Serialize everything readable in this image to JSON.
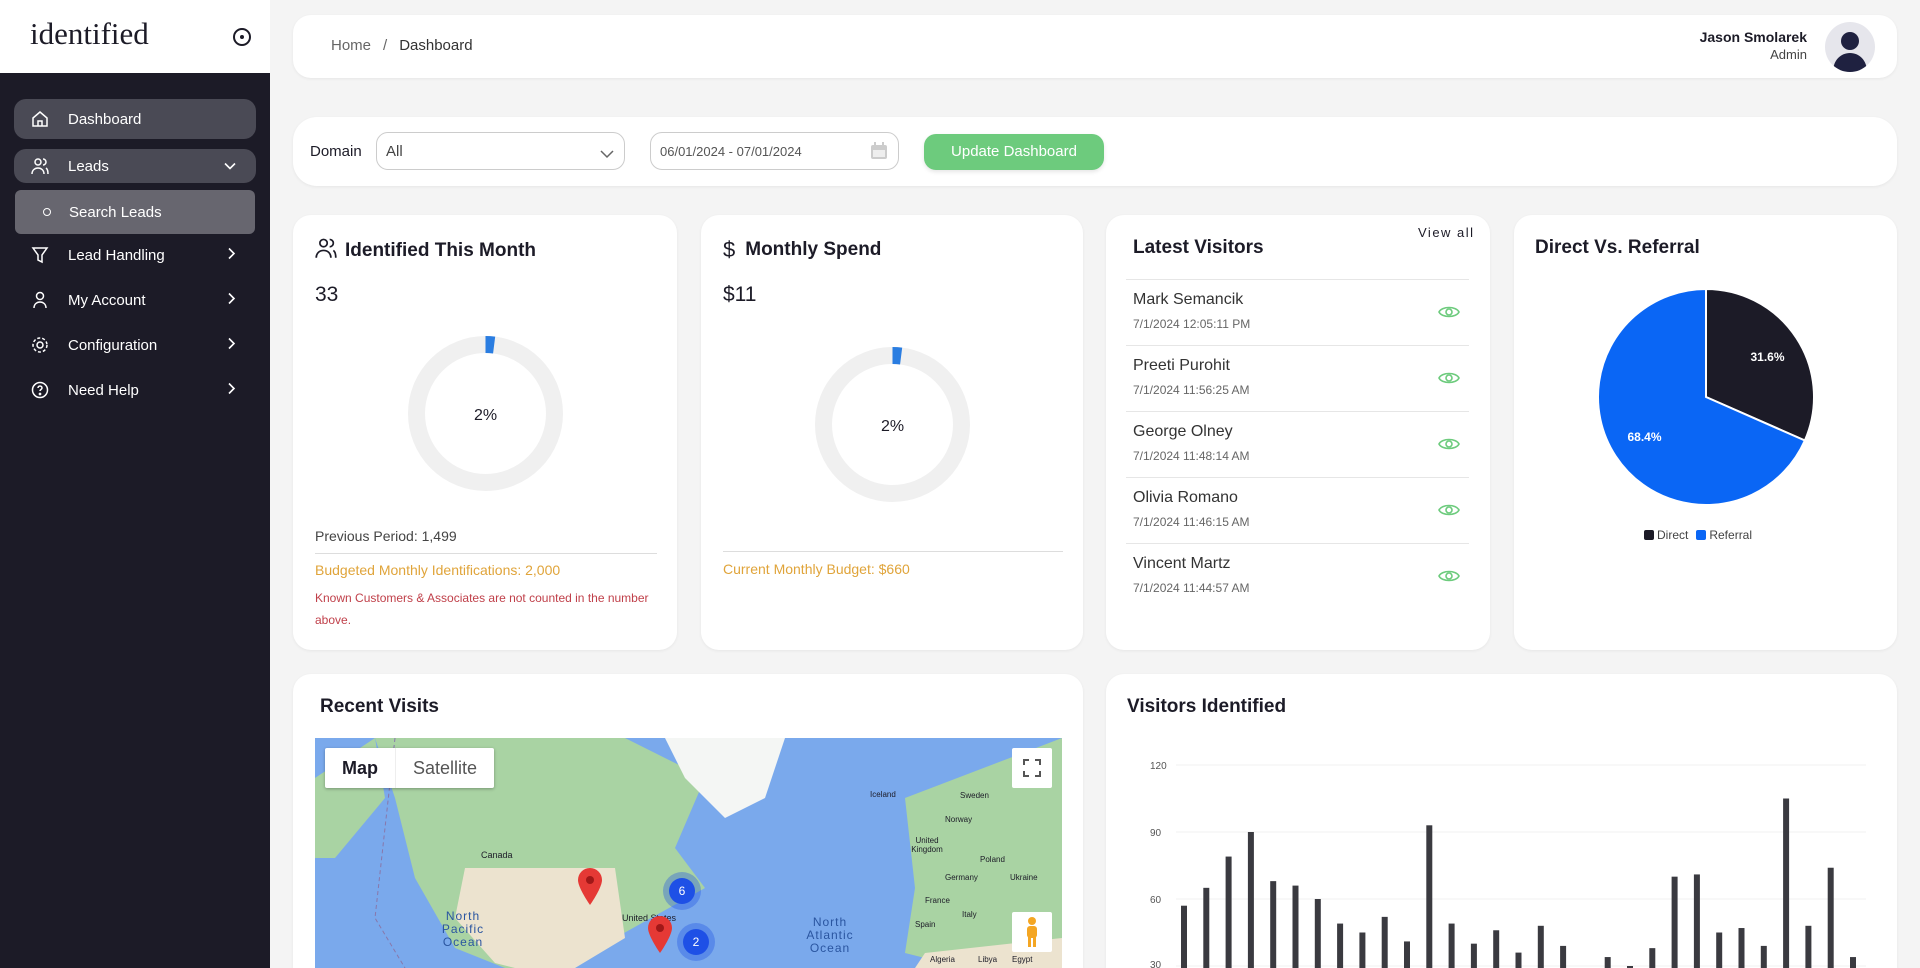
{
  "brand": {
    "logo": "identified"
  },
  "sidebar": {
    "items": [
      {
        "label": "Dashboard",
        "icon": "home-icon"
      },
      {
        "label": "Leads",
        "icon": "users-icon"
      },
      {
        "label": "Search Leads",
        "icon": "circle-icon"
      },
      {
        "label": "Lead Handling",
        "icon": "filter-icon"
      },
      {
        "label": "My Account",
        "icon": "user-icon"
      },
      {
        "label": "Configuration",
        "icon": "gear-icon"
      },
      {
        "label": "Need Help",
        "icon": "help-icon"
      }
    ]
  },
  "header": {
    "breadcrumb": [
      "Home",
      "Dashboard"
    ],
    "separator": "/",
    "user_name": "Jason Smolarek",
    "user_role": "Admin"
  },
  "filters": {
    "domain_label": "Domain",
    "domain_value": "All",
    "date_range": "06/01/2024 - 07/01/2024",
    "update_label": "Update Dashboard"
  },
  "identified": {
    "title": "Identified This Month",
    "value": "33",
    "percent_label": "2%",
    "percent": 2,
    "previous": "Previous Period: 1,499",
    "budget": "Budgeted Monthly Identifications: 2,000",
    "note": "Known Customers & Associates are not counted in the number above."
  },
  "spend": {
    "title": "Monthly Spend",
    "value": "$11",
    "percent_label": "2%",
    "percent": 2,
    "budget": "Current Monthly Budget: $660"
  },
  "visitors": {
    "title": "Latest Visitors",
    "view_all": "View all",
    "rows": [
      {
        "name": "Mark Semancik",
        "date": "7/1/2024 12:05:11 PM"
      },
      {
        "name": "Preeti Purohit",
        "date": "7/1/2024 11:56:25 AM"
      },
      {
        "name": "George Olney",
        "date": "7/1/2024 11:48:14 AM"
      },
      {
        "name": "Olivia Romano",
        "date": "7/1/2024 11:46:15 AM"
      },
      {
        "name": "Vincent Martz",
        "date": "7/1/2024 11:44:57 AM"
      }
    ]
  },
  "colors": {
    "accent_green": "#6dcb7d",
    "budget_orange": "#e0a43a",
    "note_red": "#c0404a",
    "direct": "#1c1b27",
    "referral": "#0a66f5",
    "progress": "#2a7de1"
  },
  "chart_data": [
    {
      "type": "pie",
      "title": "Direct Vs. Referral",
      "series": [
        {
          "name": "Direct",
          "value": 31.6,
          "label": "31.6%"
        },
        {
          "name": "Referral",
          "value": 68.4,
          "label": "68.4%"
        }
      ],
      "legend": "bottom"
    },
    {
      "type": "bar",
      "title": "Visitors Identified",
      "y_ticks": [
        120,
        90,
        60,
        30
      ],
      "ylim": [
        0,
        120
      ],
      "grid": true,
      "values": [
        57,
        65,
        79,
        90,
        68,
        66,
        60,
        49,
        45,
        52,
        41,
        93,
        49,
        40,
        46,
        36,
        48,
        39,
        28,
        34,
        30,
        38,
        70,
        71,
        45,
        47,
        39,
        105,
        48,
        74,
        34
      ]
    }
  ],
  "map": {
    "title": "Recent Visits",
    "map_label": "Map",
    "satellite_label": "Satellite",
    "clusters": [
      "6",
      "2"
    ],
    "labels": [
      "Canada",
      "United States",
      "North Pacific Ocean",
      "North Atlantic Ocean",
      "Iceland",
      "Norway",
      "Sweden",
      "United Kingdom",
      "Poland",
      "Germany",
      "Ukraine",
      "France",
      "Italy",
      "Spain",
      "Algeria",
      "Libya",
      "Egypt"
    ]
  }
}
